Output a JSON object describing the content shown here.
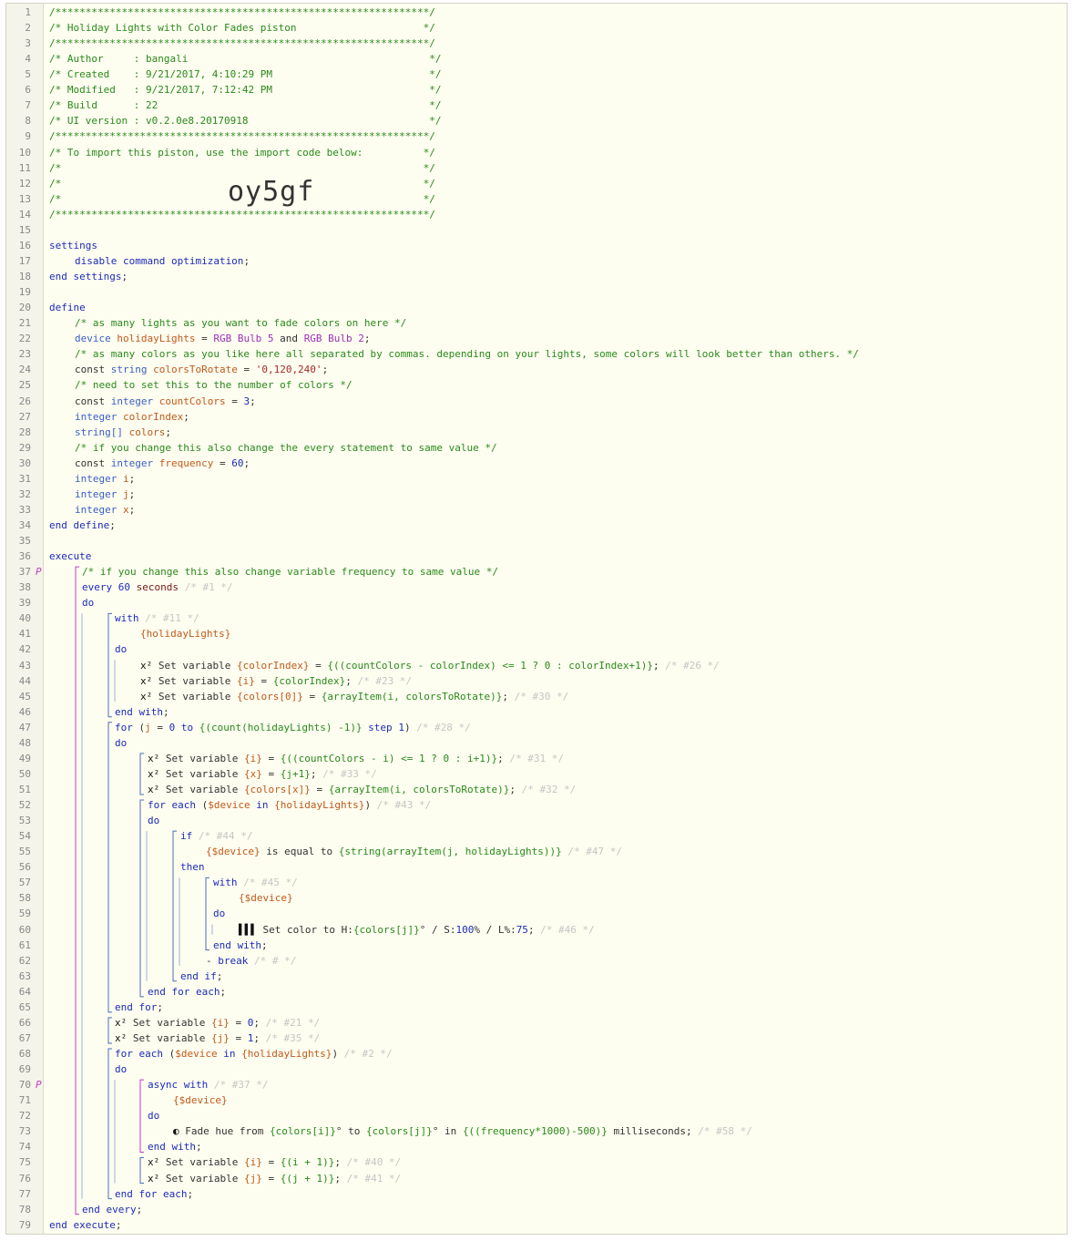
{
  "import_code": "oy5gf",
  "markers": {
    "37": "P",
    "70": "P"
  },
  "line_numbers": [
    "1",
    "2",
    "3",
    "4",
    "5",
    "6",
    "7",
    "8",
    "9",
    "10",
    "11",
    "12",
    "13",
    "14",
    "15",
    "16",
    "17",
    "18",
    "19",
    "20",
    "21",
    "22",
    "23",
    "24",
    "25",
    "26",
    "27",
    "28",
    "29",
    "30",
    "31",
    "32",
    "33",
    "34",
    "35",
    "36",
    "37",
    "38",
    "39",
    "40",
    "41",
    "42",
    "43",
    "44",
    "45",
    "46",
    "47",
    "48",
    "49",
    "50",
    "51",
    "52",
    "53",
    "54",
    "55",
    "56",
    "57",
    "58",
    "59",
    "60",
    "61",
    "62",
    "63",
    "64",
    "65",
    "66",
    "67",
    "68",
    "69",
    "70",
    "71",
    "72",
    "73",
    "74",
    "75",
    "76",
    "77",
    "78",
    "79"
  ],
  "code_lines": [
    {
      "indent": 0,
      "tokens": [
        [
          "c",
          "/**************************************************************/"
        ]
      ]
    },
    {
      "indent": 0,
      "tokens": [
        [
          "c",
          "/* Holiday Lights with Color Fades piston                     */"
        ]
      ]
    },
    {
      "indent": 0,
      "tokens": [
        [
          "c",
          "/**************************************************************/"
        ]
      ]
    },
    {
      "indent": 0,
      "tokens": [
        [
          "c",
          "/* Author     : bangali                                        */"
        ]
      ]
    },
    {
      "indent": 0,
      "tokens": [
        [
          "c",
          "/* Created    : 9/21/2017, 4:10:29 PM                          */"
        ]
      ]
    },
    {
      "indent": 0,
      "tokens": [
        [
          "c",
          "/* Modified   : 9/21/2017, 7:12:42 PM                          */"
        ]
      ]
    },
    {
      "indent": 0,
      "tokens": [
        [
          "c",
          "/* Build      : 22                                             */"
        ]
      ]
    },
    {
      "indent": 0,
      "tokens": [
        [
          "c",
          "/* UI version : v0.2.0e8.20170918                              */"
        ]
      ]
    },
    {
      "indent": 0,
      "tokens": [
        [
          "c",
          "/**************************************************************/"
        ]
      ]
    },
    {
      "indent": 0,
      "tokens": [
        [
          "c",
          "/* To import this piston, use the import code below:          */"
        ]
      ]
    },
    {
      "indent": 0,
      "tokens": [
        [
          "c",
          "/*                                                            */"
        ]
      ]
    },
    {
      "indent": 0,
      "tokens": [
        [
          "c",
          "/*                                                            */"
        ]
      ],
      "big": true
    },
    {
      "indent": 0,
      "tokens": [
        [
          "c",
          "/*                                                            */"
        ]
      ]
    },
    {
      "indent": 0,
      "tokens": [
        [
          "c",
          "/**************************************************************/"
        ]
      ]
    },
    {
      "indent": 0,
      "tokens": []
    },
    {
      "indent": 0,
      "tokens": [
        [
          "k",
          "settings"
        ]
      ]
    },
    {
      "indent": 28,
      "tokens": [
        [
          "k",
          "disable command optimization"
        ],
        [
          "p",
          ";"
        ]
      ]
    },
    {
      "indent": 0,
      "tokens": [
        [
          "k",
          "end settings"
        ],
        [
          "p",
          ";"
        ]
      ]
    },
    {
      "indent": 0,
      "tokens": []
    },
    {
      "indent": 0,
      "tokens": [
        [
          "k",
          "define"
        ]
      ]
    },
    {
      "indent": 28,
      "tokens": [
        [
          "c",
          "/* as many lights as you want to fade colors on here */"
        ]
      ]
    },
    {
      "indent": 28,
      "tokens": [
        [
          "t",
          "device "
        ],
        [
          "v",
          "holidayLights"
        ],
        [
          "p",
          " = "
        ],
        [
          "dv",
          "RGB Bulb 5"
        ],
        [
          "p",
          " and "
        ],
        [
          "dv",
          "RGB Bulb 2"
        ],
        [
          "p",
          ";"
        ]
      ]
    },
    {
      "indent": 28,
      "tokens": [
        [
          "c",
          "/* as many colors as you like here all separated by commas. depending on your lights, some colors will look better than others. */"
        ]
      ]
    },
    {
      "indent": 28,
      "tokens": [
        [
          "p",
          "const "
        ],
        [
          "t",
          "string "
        ],
        [
          "v",
          "colorsToRotate"
        ],
        [
          "p",
          " = "
        ],
        [
          "s",
          "'0,120,240'"
        ],
        [
          "p",
          ";"
        ]
      ]
    },
    {
      "indent": 28,
      "tokens": [
        [
          "c",
          "/* need to set this to the number of colors */"
        ]
      ]
    },
    {
      "indent": 28,
      "tokens": [
        [
          "p",
          "const "
        ],
        [
          "t",
          "integer "
        ],
        [
          "v",
          "countColors"
        ],
        [
          "p",
          " = "
        ],
        [
          "n",
          "3"
        ],
        [
          "p",
          ";"
        ]
      ]
    },
    {
      "indent": 28,
      "tokens": [
        [
          "t",
          "integer "
        ],
        [
          "v",
          "colorIndex"
        ],
        [
          "p",
          ";"
        ]
      ]
    },
    {
      "indent": 28,
      "tokens": [
        [
          "t",
          "string[] "
        ],
        [
          "v",
          "colors"
        ],
        [
          "p",
          ";"
        ]
      ]
    },
    {
      "indent": 28,
      "tokens": [
        [
          "c",
          "/* if you change this also change the every statement to same value */"
        ]
      ]
    },
    {
      "indent": 28,
      "tokens": [
        [
          "p",
          "const "
        ],
        [
          "t",
          "integer "
        ],
        [
          "v",
          "frequency"
        ],
        [
          "p",
          " = "
        ],
        [
          "n",
          "60"
        ],
        [
          "p",
          ";"
        ]
      ]
    },
    {
      "indent": 28,
      "tokens": [
        [
          "t",
          "integer "
        ],
        [
          "v",
          "i"
        ],
        [
          "p",
          ";"
        ]
      ]
    },
    {
      "indent": 28,
      "tokens": [
        [
          "t",
          "integer "
        ],
        [
          "v",
          "j"
        ],
        [
          "p",
          ";"
        ]
      ]
    },
    {
      "indent": 28,
      "tokens": [
        [
          "t",
          "integer "
        ],
        [
          "v",
          "x"
        ],
        [
          "p",
          ";"
        ]
      ]
    },
    {
      "indent": 0,
      "tokens": [
        [
          "k",
          "end define"
        ],
        [
          "p",
          ";"
        ]
      ]
    },
    {
      "indent": 0,
      "tokens": []
    },
    {
      "indent": 0,
      "tokens": [
        [
          "k",
          "execute"
        ]
      ]
    },
    {
      "indent": 36,
      "tokens": [
        [
          "c",
          "/* if you change this also change variable frequency to same value */"
        ]
      ]
    },
    {
      "indent": 36,
      "tokens": [
        [
          "k",
          "every "
        ],
        [
          "n",
          "60"
        ],
        [
          "u",
          " seconds"
        ],
        [
          "cf",
          " /* #1 */"
        ]
      ]
    },
    {
      "indent": 36,
      "tokens": [
        [
          "k",
          "do"
        ]
      ]
    },
    {
      "indent": 72,
      "tokens": [
        [
          "k",
          "with"
        ],
        [
          "cf",
          " /* #11 */"
        ]
      ]
    },
    {
      "indent": 100,
      "tokens": [
        [
          "v",
          "{holidayLights}"
        ]
      ]
    },
    {
      "indent": 72,
      "tokens": [
        [
          "k",
          "do"
        ]
      ]
    },
    {
      "indent": 100,
      "tokens": [
        [
          "ic",
          "x² "
        ],
        [
          "p",
          "Set variable "
        ],
        [
          "v",
          "{colorIndex}"
        ],
        [
          "p",
          " = "
        ],
        [
          "e",
          "{((countColors - colorIndex) <= 1 ? 0 : colorIndex+1)}"
        ],
        [
          "p",
          ";"
        ],
        [
          "cf",
          " /* #26 */"
        ]
      ]
    },
    {
      "indent": 100,
      "tokens": [
        [
          "ic",
          "x² "
        ],
        [
          "p",
          "Set variable "
        ],
        [
          "v",
          "{i}"
        ],
        [
          "p",
          " = "
        ],
        [
          "e",
          "{colorIndex}"
        ],
        [
          "p",
          ";"
        ],
        [
          "cf",
          " /* #23 */"
        ]
      ]
    },
    {
      "indent": 100,
      "tokens": [
        [
          "ic",
          "x² "
        ],
        [
          "p",
          "Set variable "
        ],
        [
          "v",
          "{colors[0]}"
        ],
        [
          "p",
          " = "
        ],
        [
          "e",
          "{arrayItem(i, colorsToRotate)}"
        ],
        [
          "p",
          ";"
        ],
        [
          "cf",
          " /* #30 */"
        ]
      ]
    },
    {
      "indent": 72,
      "tokens": [
        [
          "k",
          "end with"
        ],
        [
          "p",
          ";"
        ]
      ]
    },
    {
      "indent": 72,
      "tokens": [
        [
          "k",
          "for "
        ],
        [
          "p",
          "("
        ],
        [
          "v",
          "j"
        ],
        [
          "p",
          " = "
        ],
        [
          "n",
          "0"
        ],
        [
          "k",
          " to "
        ],
        [
          "e",
          "{(count(holidayLights) -1)}"
        ],
        [
          "k",
          " step "
        ],
        [
          "n",
          "1"
        ],
        [
          "p",
          ")"
        ],
        [
          "cf",
          " /* #28 */"
        ]
      ]
    },
    {
      "indent": 72,
      "tokens": [
        [
          "k",
          "do"
        ]
      ]
    },
    {
      "indent": 108,
      "tokens": [
        [
          "ic",
          "x² "
        ],
        [
          "p",
          "Set variable "
        ],
        [
          "v",
          "{i}"
        ],
        [
          "p",
          " = "
        ],
        [
          "e",
          "{((countColors - i) <= 1 ? 0 : i+1)}"
        ],
        [
          "p",
          ";"
        ],
        [
          "cf",
          " /* #31 */"
        ]
      ]
    },
    {
      "indent": 108,
      "tokens": [
        [
          "ic",
          "x² "
        ],
        [
          "p",
          "Set variable "
        ],
        [
          "v",
          "{x}"
        ],
        [
          "p",
          " = "
        ],
        [
          "e",
          "{j+1}"
        ],
        [
          "p",
          ";"
        ],
        [
          "cf",
          " /* #33 */"
        ]
      ]
    },
    {
      "indent": 108,
      "tokens": [
        [
          "ic",
          "x² "
        ],
        [
          "p",
          "Set variable "
        ],
        [
          "v",
          "{colors[x]}"
        ],
        [
          "p",
          " = "
        ],
        [
          "e",
          "{arrayItem(i, colorsToRotate)}"
        ],
        [
          "p",
          ";"
        ],
        [
          "cf",
          " /* #32 */"
        ]
      ]
    },
    {
      "indent": 108,
      "tokens": [
        [
          "k",
          "for each "
        ],
        [
          "p",
          "("
        ],
        [
          "v",
          "$device"
        ],
        [
          "k",
          " in "
        ],
        [
          "v",
          "{holidayLights}"
        ],
        [
          "p",
          ")"
        ],
        [
          "cf",
          " /* #43 */"
        ]
      ]
    },
    {
      "indent": 108,
      "tokens": [
        [
          "k",
          "do"
        ]
      ]
    },
    {
      "indent": 144,
      "tokens": [
        [
          "k",
          "if"
        ],
        [
          "cf",
          " /* #44 */"
        ]
      ]
    },
    {
      "indent": 172,
      "tokens": [
        [
          "v",
          "{$device}"
        ],
        [
          "p",
          " is equal to "
        ],
        [
          "e",
          "{string(arrayItem(j, holidayLights))}"
        ],
        [
          "cf",
          " /* #47 */"
        ]
      ]
    },
    {
      "indent": 144,
      "tokens": [
        [
          "k",
          "then"
        ]
      ]
    },
    {
      "indent": 180,
      "tokens": [
        [
          "k",
          "with"
        ],
        [
          "cf",
          " /* #45 */"
        ]
      ]
    },
    {
      "indent": 208,
      "tokens": [
        [
          "v",
          "{$device}"
        ]
      ]
    },
    {
      "indent": 180,
      "tokens": [
        [
          "k",
          "do"
        ]
      ]
    },
    {
      "indent": 208,
      "tokens": [
        [
          "ic",
          "▌▌▌ "
        ],
        [
          "p",
          "Set color to H:"
        ],
        [
          "e",
          "{colors[j]}"
        ],
        [
          "p",
          "° / S:"
        ],
        [
          "n",
          "100"
        ],
        [
          "p",
          "% / L%:"
        ],
        [
          "n",
          "75"
        ],
        [
          "p",
          ";"
        ],
        [
          "cf",
          " /* #46 */"
        ]
      ]
    },
    {
      "indent": 180,
      "tokens": [
        [
          "k",
          "end with"
        ],
        [
          "p",
          ";"
        ]
      ]
    },
    {
      "indent": 172,
      "tokens": [
        [
          "p",
          "- "
        ],
        [
          "k",
          "break"
        ],
        [
          "cf",
          " /* # */"
        ]
      ]
    },
    {
      "indent": 144,
      "tokens": [
        [
          "k",
          "end if"
        ],
        [
          "p",
          ";"
        ]
      ]
    },
    {
      "indent": 108,
      "tokens": [
        [
          "k",
          "end for each"
        ],
        [
          "p",
          ";"
        ]
      ]
    },
    {
      "indent": 72,
      "tokens": [
        [
          "k",
          "end for"
        ],
        [
          "p",
          ";"
        ]
      ]
    },
    {
      "indent": 72,
      "tokens": [
        [
          "ic",
          "x² "
        ],
        [
          "p",
          "Set variable "
        ],
        [
          "v",
          "{i}"
        ],
        [
          "p",
          " = "
        ],
        [
          "n",
          "0"
        ],
        [
          "p",
          ";"
        ],
        [
          "cf",
          " /* #21 */"
        ]
      ]
    },
    {
      "indent": 72,
      "tokens": [
        [
          "ic",
          "x² "
        ],
        [
          "p",
          "Set variable "
        ],
        [
          "v",
          "{j}"
        ],
        [
          "p",
          " = "
        ],
        [
          "n",
          "1"
        ],
        [
          "p",
          ";"
        ],
        [
          "cf",
          " /* #35 */"
        ]
      ]
    },
    {
      "indent": 72,
      "tokens": [
        [
          "k",
          "for each "
        ],
        [
          "p",
          "("
        ],
        [
          "v",
          "$device"
        ],
        [
          "k",
          " in "
        ],
        [
          "v",
          "{holidayLights}"
        ],
        [
          "p",
          ")"
        ],
        [
          "cf",
          " /* #2 */"
        ]
      ]
    },
    {
      "indent": 72,
      "tokens": [
        [
          "k",
          "do"
        ]
      ]
    },
    {
      "indent": 108,
      "tokens": [
        [
          "k",
          "async with"
        ],
        [
          "cf",
          " /* #37 */"
        ]
      ]
    },
    {
      "indent": 136,
      "tokens": [
        [
          "v",
          "{$device}"
        ]
      ]
    },
    {
      "indent": 108,
      "tokens": [
        [
          "k",
          "do"
        ]
      ]
    },
    {
      "indent": 136,
      "tokens": [
        [
          "ic",
          "◐ "
        ],
        [
          "p",
          "Fade hue from "
        ],
        [
          "e",
          "{colors[i]}"
        ],
        [
          "p",
          "° to "
        ],
        [
          "e",
          "{colors[j]}"
        ],
        [
          "p",
          "° in "
        ],
        [
          "e",
          "{((frequency*1000)-500)}"
        ],
        [
          "p",
          " milliseconds;"
        ],
        [
          "cf",
          " /* #58 */"
        ]
      ]
    },
    {
      "indent": 108,
      "tokens": [
        [
          "k",
          "end with"
        ],
        [
          "p",
          ";"
        ]
      ]
    },
    {
      "indent": 108,
      "tokens": [
        [
          "ic",
          "x² "
        ],
        [
          "p",
          "Set variable "
        ],
        [
          "v",
          "{i}"
        ],
        [
          "p",
          " = "
        ],
        [
          "e",
          "{(i + 1)}"
        ],
        [
          "p",
          ";"
        ],
        [
          "cf",
          " /* #40 */"
        ]
      ]
    },
    {
      "indent": 108,
      "tokens": [
        [
          "ic",
          "x² "
        ],
        [
          "p",
          "Set variable "
        ],
        [
          "v",
          "{j}"
        ],
        [
          "p",
          " = "
        ],
        [
          "e",
          "{(j + 1)}"
        ],
        [
          "p",
          ";"
        ],
        [
          "cf",
          " /* #41 */"
        ]
      ]
    },
    {
      "indent": 72,
      "tokens": [
        [
          "k",
          "end for each"
        ],
        [
          "p",
          ";"
        ]
      ]
    },
    {
      "indent": 36,
      "tokens": [
        [
          "k",
          "end every"
        ],
        [
          "p",
          ";"
        ]
      ]
    },
    {
      "indent": 0,
      "tokens": [
        [
          "k",
          "end execute"
        ],
        [
          "p",
          ";"
        ]
      ]
    }
  ],
  "colors": {
    "editor_bg": "#fdfdf0",
    "gutter_bg": "#f4f4ea",
    "comment": "#2a8a1a",
    "keyword": "#1d2bb8",
    "variable": "#c05a1a",
    "device": "#9b2fb8",
    "bracket": "#c040c0"
  }
}
